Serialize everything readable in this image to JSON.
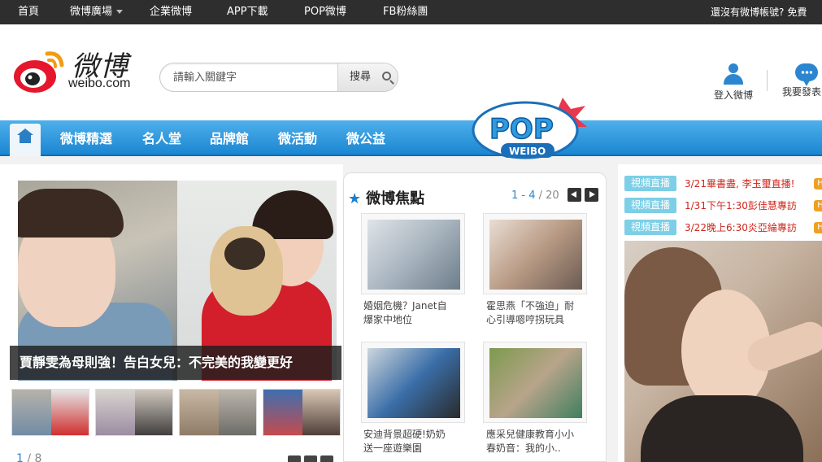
{
  "top_nav": {
    "items": [
      "首頁",
      "微博廣場",
      "企業微博",
      "APP下載",
      "POP微博",
      "FB粉絲團"
    ],
    "right_text": "還沒有微博帳號?",
    "right_link": "免費"
  },
  "header": {
    "logo_cn": "微博",
    "logo_en": "weibo.com",
    "search_placeholder": "請輸入關鍵字",
    "search_button": "搜尋",
    "login_label": "登入微博",
    "post_label": "我要發表"
  },
  "nav": {
    "items": [
      "微博精選",
      "名人堂",
      "品牌館",
      "微活動",
      "微公益"
    ],
    "badge_top": "POP",
    "badge_bottom": "WEIBO",
    "badge_exclaim": "!"
  },
  "featured": {
    "caption": "賈靜雯為母則強！告白女兒：不完美的我變更好",
    "pager_current": "1",
    "pager_total": "/ 8"
  },
  "focus": {
    "title": "微博焦點",
    "range": "1 - 4",
    "total": "/ 20",
    "cards": [
      {
        "line1": "婚姻危機？Janet自",
        "line2": "爆家中地位"
      },
      {
        "line1": "霍思燕「不強迫」耐",
        "line2": "心引導嗯哼拐玩具"
      },
      {
        "line1": "安迪背景超硬!奶奶",
        "line2": "送一座遊樂園"
      },
      {
        "line1": "應采兒健康教育小小",
        "line2": "春奶音：我的小.."
      }
    ]
  },
  "live": {
    "tag": "視頻直播",
    "items": [
      {
        "text": "3/21畢書盡, 李玉璽直播!",
        "badge": "H"
      },
      {
        "text": "1/31下午1:30彭佳慧專訪",
        "badge": "H"
      },
      {
        "text": "3/22晚上6:30炎亞綸專訪",
        "badge": "H"
      }
    ]
  },
  "colors": {
    "nav_blue": "#1a86d2",
    "accent_blue": "#2b86cf",
    "live_tag": "#7ccfe6",
    "live_text": "#d0261c",
    "topbar": "#2e2e2e"
  }
}
